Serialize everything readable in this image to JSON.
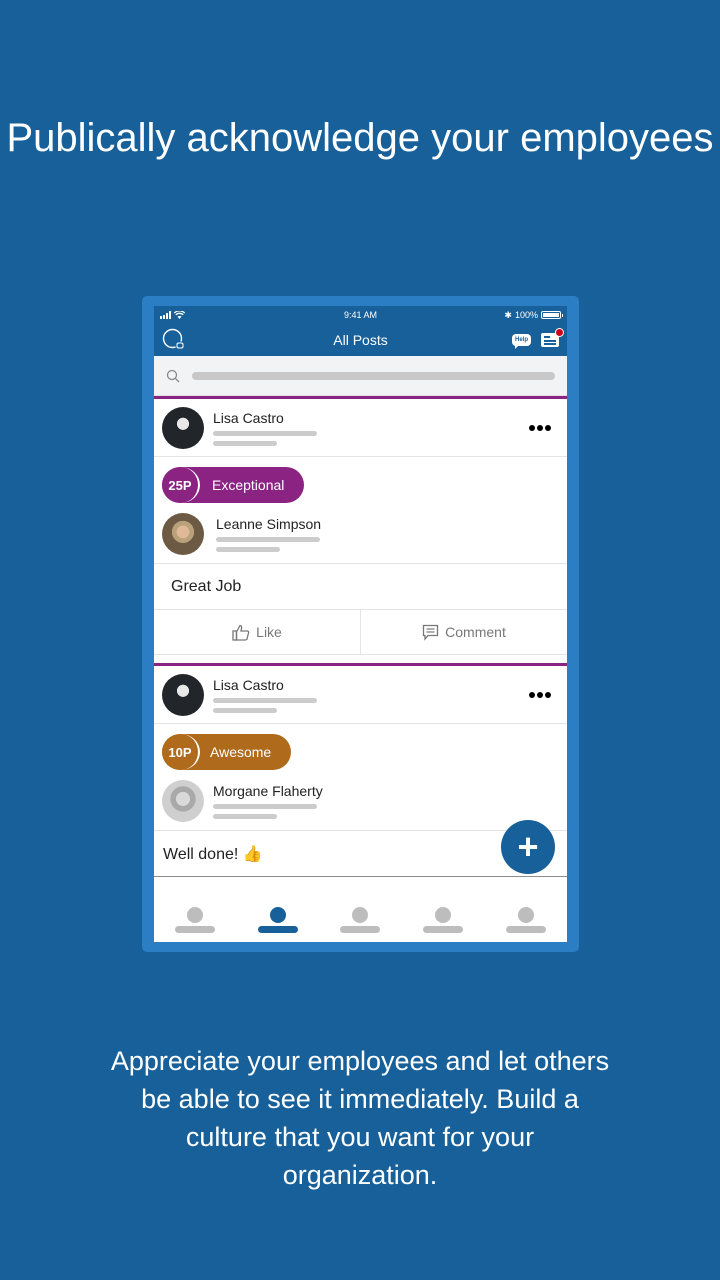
{
  "headline": "Publically acknowledge your employees",
  "subtext": "Appreciate your employees and let others be able to see it immediately. Build a culture that you want for your organization.",
  "colors": {
    "background": "#17609a",
    "frame": "#2b7ec4",
    "exceptional": "#8b2383",
    "awesome": "#b06a1c",
    "notification_dot": "#d0021b"
  },
  "status_bar": {
    "time": "9:41 AM",
    "battery": "100%"
  },
  "nav": {
    "title": "All Posts",
    "help_label": "Help",
    "left_icon": "profile-chat-icon",
    "right_icon": "news-icon"
  },
  "search": {
    "icon": "search-icon"
  },
  "posts": [
    {
      "author": "Lisa Castro",
      "award_points": "25P",
      "award_label": "Exceptional",
      "recipient": "Leanne Simpson",
      "message": "Great Job",
      "like_label": "Like",
      "comment_label": "Comment"
    },
    {
      "author": "Lisa Castro",
      "award_points": "10P",
      "award_label": "Awesome",
      "recipient": "Morgane Flaherty",
      "message": "Well done! 👍"
    }
  ],
  "fab": {
    "label": "+"
  },
  "tabbar": {
    "active_index": 1,
    "count": 5
  }
}
